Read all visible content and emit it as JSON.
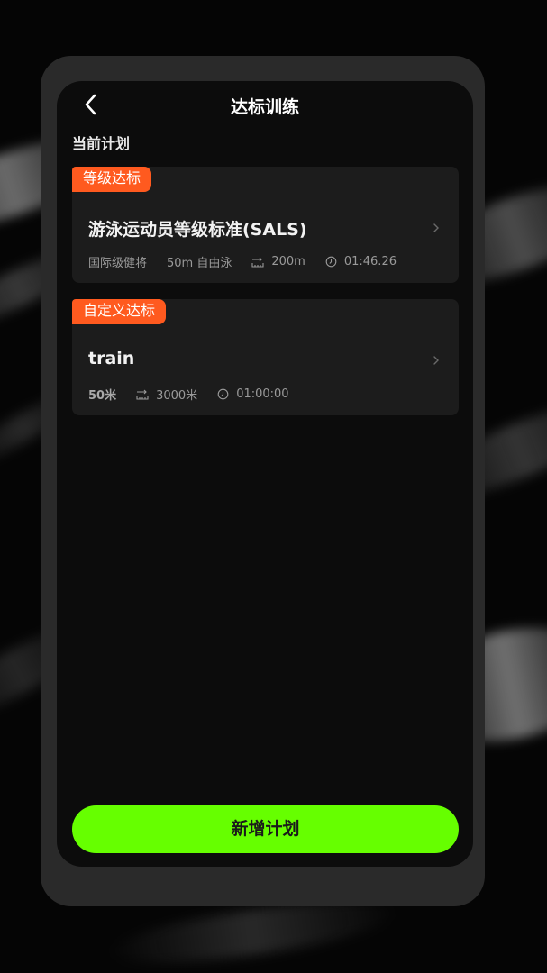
{
  "header": {
    "title": "达标训练"
  },
  "section": {
    "current_plan_label": "当前计划"
  },
  "plans": [
    {
      "tag": "等级达标",
      "title": "游泳运动员等级标准(SALS)",
      "level": "国际级健将",
      "event": "50m 自由泳",
      "distance": "200m",
      "time": "01:46.26"
    },
    {
      "tag": "自定义达标",
      "title": "train",
      "pool": "50米",
      "distance": "3000米",
      "time": "01:00:00"
    }
  ],
  "footer": {
    "add_button_label": "新增计划"
  },
  "colors": {
    "accent_orange": "#ff5a1f",
    "accent_green": "#66ff00"
  },
  "icons": [
    "back-arrow-icon",
    "chevron-right-icon",
    "distance-icon",
    "clock-icon"
  ]
}
